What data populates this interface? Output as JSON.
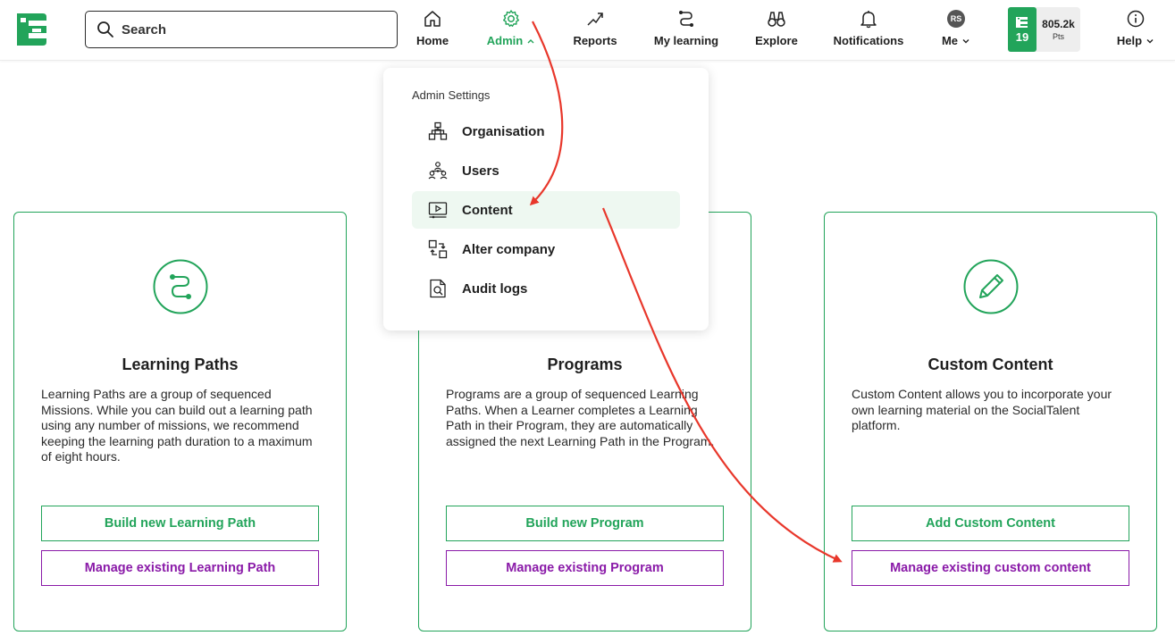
{
  "search": {
    "placeholder": "Search"
  },
  "nav": {
    "home": "Home",
    "admin": "Admin",
    "reports": "Reports",
    "my_learning": "My learning",
    "explore": "Explore",
    "notifications": "Notifications",
    "me": "Me",
    "me_initials": "RS",
    "help": "Help"
  },
  "points": {
    "level": "19",
    "value": "805.2k",
    "unit": "Pts"
  },
  "dropdown": {
    "heading": "Admin Settings",
    "items": [
      {
        "label": "Organisation",
        "icon": "org-chart-icon"
      },
      {
        "label": "Users",
        "icon": "users-icon"
      },
      {
        "label": "Content",
        "icon": "content-video-icon"
      },
      {
        "label": "Alter company",
        "icon": "switch-company-icon"
      },
      {
        "label": "Audit logs",
        "icon": "audit-log-icon"
      }
    ]
  },
  "cards": [
    {
      "title": "Learning Paths",
      "description": "Learning Paths are a group of sequenced Missions. While you can build out a learning path using any number of missions, we recommend keeping the learning path duration to a maximum of eight hours.",
      "primary": "Build new Learning Path",
      "secondary": "Manage existing Learning Path",
      "icon": "learning-path-icon"
    },
    {
      "title": "Programs",
      "description": "Programs are a group of sequenced Learning Paths. When a Learner completes a Learning Path in their Program, they are automatically assigned the next Learning Path in the Program.",
      "primary": "Build new Program",
      "secondary": "Manage existing Program",
      "icon": "program-icon"
    },
    {
      "title": "Custom Content",
      "description": "Custom Content allows you to incorporate your own learning material on the SocialTalent platform.",
      "primary": "Add Custom Content",
      "secondary": "Manage existing custom content",
      "icon": "pencil-icon"
    }
  ],
  "colors": {
    "brand_green": "#22a45a",
    "purple": "#8a1aa8",
    "annotation_red": "#e8372b"
  }
}
